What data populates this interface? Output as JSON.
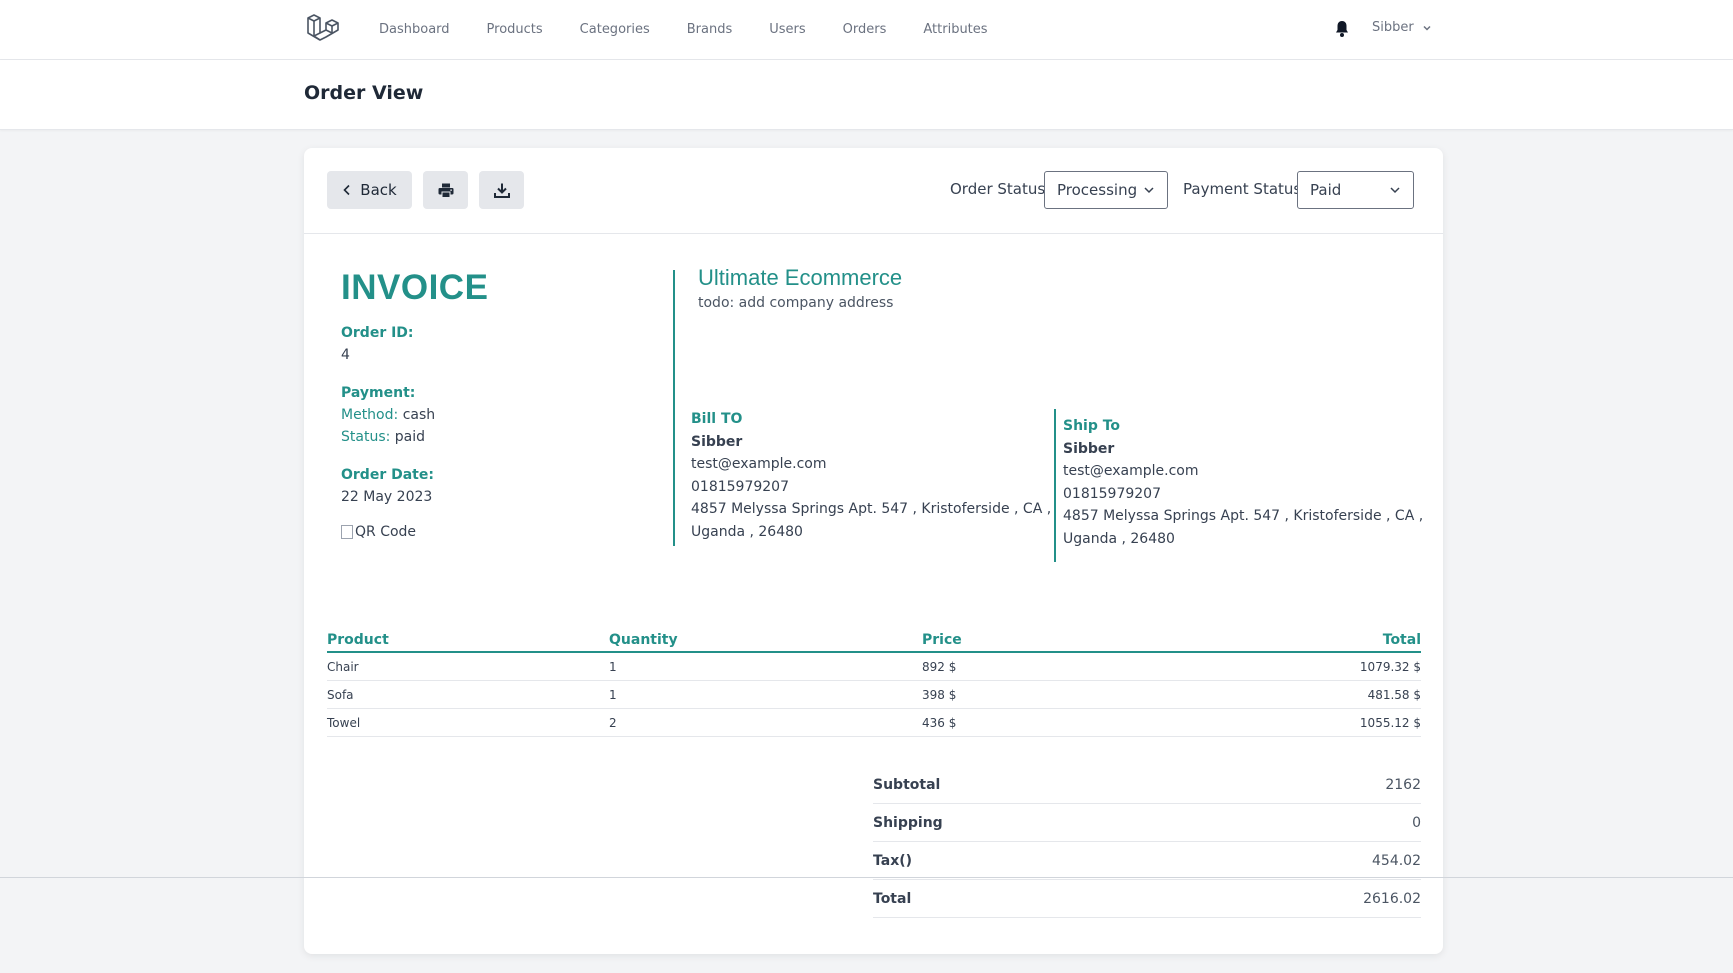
{
  "nav": {
    "links": [
      "Dashboard",
      "Products",
      "Categories",
      "Brands",
      "Users",
      "Orders",
      "Attributes"
    ],
    "user_name": "Sibber"
  },
  "header": {
    "title": "Order View"
  },
  "toolbar": {
    "back_label": "Back",
    "order_status_label": "Order Status:",
    "order_status_value": "Processing",
    "payment_status_label": "Payment Status:",
    "payment_status_value": "Paid"
  },
  "invoice": {
    "title": "INVOICE",
    "order_id_label": "Order ID:",
    "order_id": "4",
    "payment_label": "Payment:",
    "method_label": "Method:",
    "method_value": "cash",
    "status_label": "Status:",
    "status_value": "paid",
    "order_date_label": "Order Date:",
    "order_date": "22 May 2023",
    "qr_alt": "QR Code"
  },
  "company": {
    "name": "Ultimate Ecommerce",
    "address": "todo: add company address"
  },
  "bill_to": {
    "title": "Bill TO",
    "name": "Sibber",
    "email": "test@example.com",
    "phone": "01815979207",
    "address_line1": "4857 Melyssa Springs Apt. 547 , Kristoferside , CA ,",
    "address_line2": "Uganda , 26480"
  },
  "ship_to": {
    "title": "Ship To",
    "name": "Sibber",
    "email": "test@example.com",
    "phone": "01815979207",
    "address_line1": "4857 Melyssa Springs Apt. 547 , Kristoferside , CA ,",
    "address_line2": "Uganda , 26480"
  },
  "items": {
    "headers": {
      "product": "Product",
      "quantity": "Quantity",
      "price": "Price",
      "total": "Total"
    },
    "rows": [
      {
        "product": "Chair",
        "quantity": "1",
        "price": "892 $",
        "total": "1079.32 $"
      },
      {
        "product": "Sofa",
        "quantity": "1",
        "price": "398 $",
        "total": "481.58 $"
      },
      {
        "product": "Towel",
        "quantity": "2",
        "price": "436 $",
        "total": "1055.12 $"
      }
    ]
  },
  "totals": {
    "subtotal_label": "Subtotal",
    "subtotal": "2162",
    "shipping_label": "Shipping",
    "shipping": "0",
    "tax_label": "Tax()",
    "tax": "454.02",
    "total_label": "Total",
    "total": "2616.02"
  },
  "colors": {
    "accent": "#239089",
    "background": "#f3f4f6"
  },
  "icons": [
    "laravel-logo-icon",
    "bell-icon",
    "chevron-down-icon",
    "chevron-left-icon",
    "printer-icon",
    "download-icon"
  ]
}
